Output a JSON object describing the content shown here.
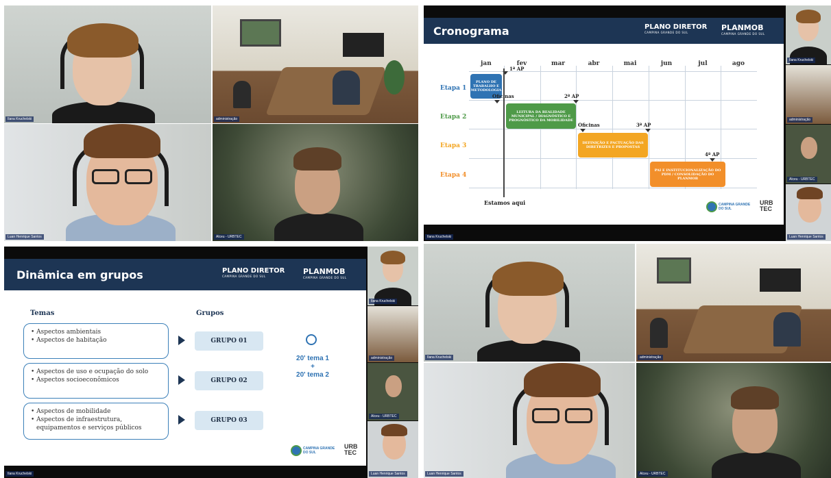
{
  "participants": {
    "ilana": "Ilana Kruchelski",
    "admin": "administração",
    "luan": "Luan Henrique Santos",
    "alceu": "Alceu - URBTEC"
  },
  "slide_crono": {
    "title": "Cronograma",
    "logo1": "PLANO DIRETOR",
    "logo1_sub": "CAMPINA GRANDE DO SUL",
    "logo2": "PLANMOB",
    "logo2_sub": "CAMPINA GRANDE DO SUL",
    "months": [
      "jan",
      "fev",
      "mar",
      "abr",
      "mai",
      "jun",
      "jul",
      "ago"
    ],
    "etapas": [
      "Etapa 1",
      "Etapa 2",
      "Etapa 3",
      "Etapa 4"
    ],
    "bar1": "PLANO DE TRABALHO E METODOLOGIA",
    "bar2": "LEITURA DA REALIDADE MUNICIPAL / DIAGNÓSTICO E PROGNÓSTICO DA MOBILIDADE",
    "bar3": "DEFINIÇÃO E PACTUAÇÃO DAS DIRETRIZES E PROPOSTAS",
    "bar4": "PAI E INSTITUCIONALIZAÇÃO DO PDM / CONSOLIDAÇÃO DO PLANMOB",
    "ap1": "1ª AP",
    "ap2": "2ª AP",
    "ap3": "3ª AP",
    "ap4": "4ª AP",
    "oficinas1": "Oficinas",
    "oficinas2": "Oficinas",
    "estamos": "Estamos aqui",
    "footer_logo": "CAMPINA GRANDE DO SUL",
    "footer_urb": "URB TEC"
  },
  "slide_grupos": {
    "title": "Dinâmica em grupos",
    "logo1": "PLANO DIRETOR",
    "logo1_sub": "CAMPINA GRANDE DO SUL",
    "logo2": "PLANMOB",
    "logo2_sub": "CAMPINA GRANDE DO SUL",
    "temas_label": "Temas",
    "grupos_label": "Grupos",
    "box1": [
      "• Aspectos ambientais",
      "• Aspectos de habitação"
    ],
    "box2": [
      "• Aspectos de uso e ocupação do solo",
      "• Aspectos socioeconômicos"
    ],
    "box3": [
      "• Aspectos de mobilidade",
      "• Aspectos de infraestrutura,",
      "equipamentos e serviços públicos"
    ],
    "grupos": [
      "GRUPO 01",
      "GRUPO 02",
      "GRUPO 03"
    ],
    "timer1": "20' tema 1",
    "plus": "+",
    "timer2": "20' tema 2",
    "footer_logo": "CAMPINA GRANDE DO SUL",
    "footer_urb": "URB TEC"
  },
  "colors": {
    "navy": "#1d3554",
    "etapa1": "#2f73b3",
    "etapa2": "#4e9a48",
    "etapa3": "#f3a623",
    "etapa4": "#f28f2a"
  }
}
